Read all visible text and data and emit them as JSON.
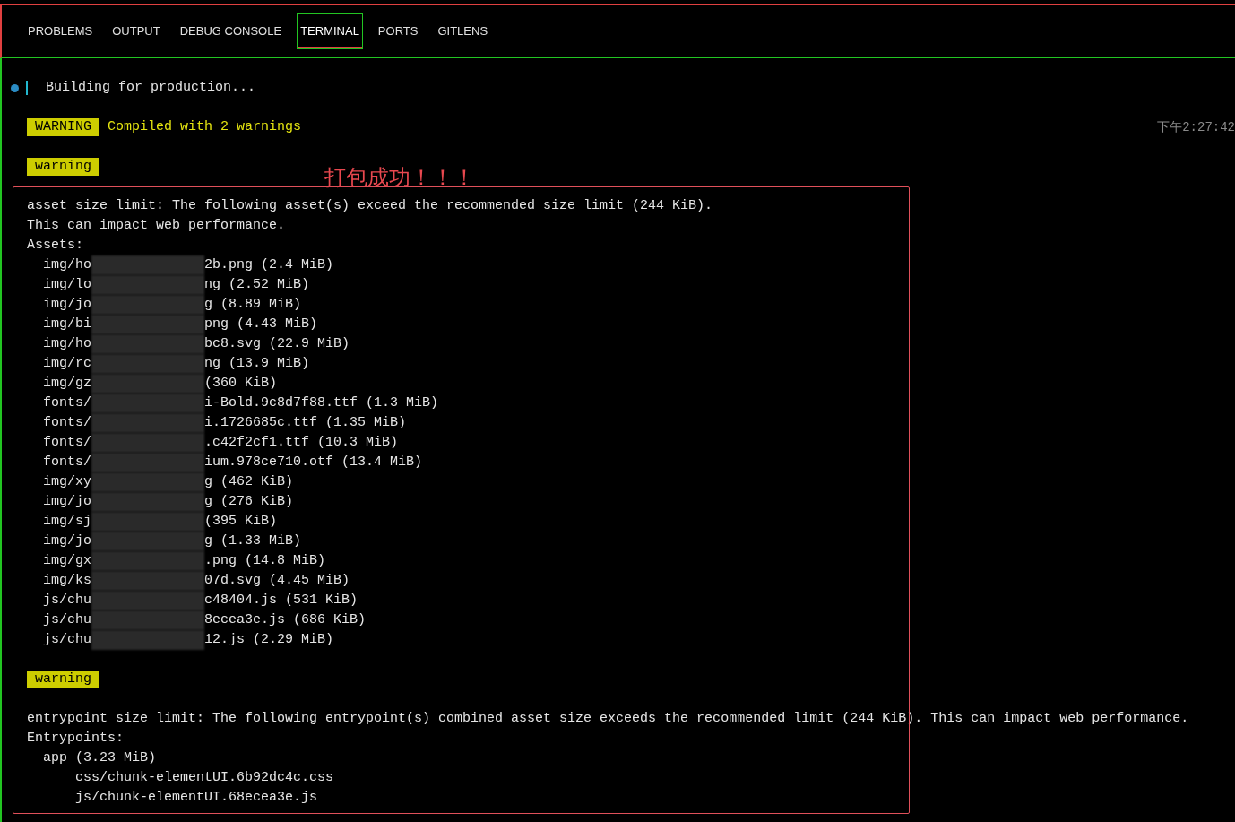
{
  "tabs": [
    {
      "label": "PROBLEMS",
      "selected": false
    },
    {
      "label": "OUTPUT",
      "selected": false
    },
    {
      "label": "DEBUG CONSOLE",
      "selected": false
    },
    {
      "label": "TERMINAL",
      "selected": true
    },
    {
      "label": "PORTS",
      "selected": false
    },
    {
      "label": "GITLENS",
      "selected": false
    }
  ],
  "terminal": {
    "lines": [
      {
        "kind": "status",
        "text": "Building for production..."
      },
      {
        "kind": "blank"
      },
      {
        "kind": "badge",
        "badge": "WARNING",
        "text": "Compiled with 2 warnings",
        "timestamp": "下午2:27:42"
      },
      {
        "kind": "blank"
      },
      {
        "kind": "badge",
        "badge": "warning"
      },
      {
        "kind": "blank"
      },
      {
        "kind": "text",
        "text": "asset size limit: The following asset(s) exceed the recommended size limit (244 KiB)."
      },
      {
        "kind": "text",
        "text": "This can impact web performance."
      },
      {
        "kind": "text",
        "text": "Assets:",
        "children": [
          {
            "kind": "redacted",
            "prefix": "img/ho",
            "suffix": "2b.png (2.4 MiB)"
          },
          {
            "kind": "redacted",
            "prefix": "img/lo",
            "suffix": "ng (2.52 MiB)"
          },
          {
            "kind": "redacted",
            "prefix": "img/jo",
            "suffix": "g (8.89 MiB)"
          },
          {
            "kind": "redacted",
            "prefix": "img/bi",
            "suffix": "png (4.43 MiB)"
          },
          {
            "kind": "redacted",
            "prefix": "img/ho",
            "suffix": "bc8.svg (22.9 MiB)"
          },
          {
            "kind": "redacted",
            "prefix": "img/rc",
            "suffix": "ng (13.9 MiB)"
          },
          {
            "kind": "redacted",
            "prefix": "img/gz",
            "suffix": "(360 KiB)"
          },
          {
            "kind": "redacted",
            "prefix": "fonts/",
            "suffix": "i-Bold.9c8d7f88.ttf (1.3 MiB)"
          },
          {
            "kind": "redacted",
            "prefix": "fonts/",
            "suffix": "i.1726685c.ttf (1.35 MiB)"
          },
          {
            "kind": "redacted",
            "prefix": "fonts/",
            "suffix": ".c42f2cf1.ttf (10.3 MiB)"
          },
          {
            "kind": "redacted",
            "prefix": "fonts/",
            "suffix": "ium.978ce710.otf (13.4 MiB)"
          },
          {
            "kind": "redacted",
            "prefix": "img/xy",
            "suffix": "g (462 KiB)"
          },
          {
            "kind": "redacted",
            "prefix": "img/jo",
            "suffix": "g (276 KiB)"
          },
          {
            "kind": "redacted",
            "prefix": "img/sj",
            "suffix": "(395 KiB)"
          },
          {
            "kind": "redacted",
            "prefix": "img/jo",
            "suffix": "g (1.33 MiB)"
          },
          {
            "kind": "redacted",
            "prefix": "img/gx",
            "suffix": ".png (14.8 MiB)"
          },
          {
            "kind": "redacted",
            "prefix": "img/ks",
            "suffix": "07d.svg (4.45 MiB)"
          },
          {
            "kind": "redacted",
            "prefix": "js/chu",
            "suffix": "c48404.js (531 KiB)"
          },
          {
            "kind": "redacted",
            "prefix": "js/chu",
            "suffix": "8ecea3e.js (686 KiB)"
          },
          {
            "kind": "redacted",
            "prefix": "js/chu",
            "suffix": "12.js (2.29 MiB)"
          }
        ]
      },
      {
        "kind": "blank"
      },
      {
        "kind": "badge",
        "badge": "warning"
      },
      {
        "kind": "blank"
      },
      {
        "kind": "text",
        "text": "entrypoint size limit: The following entrypoint(s) combined asset size exceeds the recommended limit (244 KiB). This can impact web performance."
      },
      {
        "kind": "text",
        "text": "Entrypoints:",
        "children": [
          {
            "kind": "text",
            "text": "app (3.23 MiB)",
            "children": [
              {
                "kind": "text",
                "text": "css/chunk-elementUI.6b92dc4c.css"
              },
              {
                "kind": "text",
                "text": "js/chunk-elementUI.68ecea3e.js"
              }
            ]
          }
        ]
      }
    ]
  },
  "annotation": {
    "text": "打包成功！！！"
  }
}
